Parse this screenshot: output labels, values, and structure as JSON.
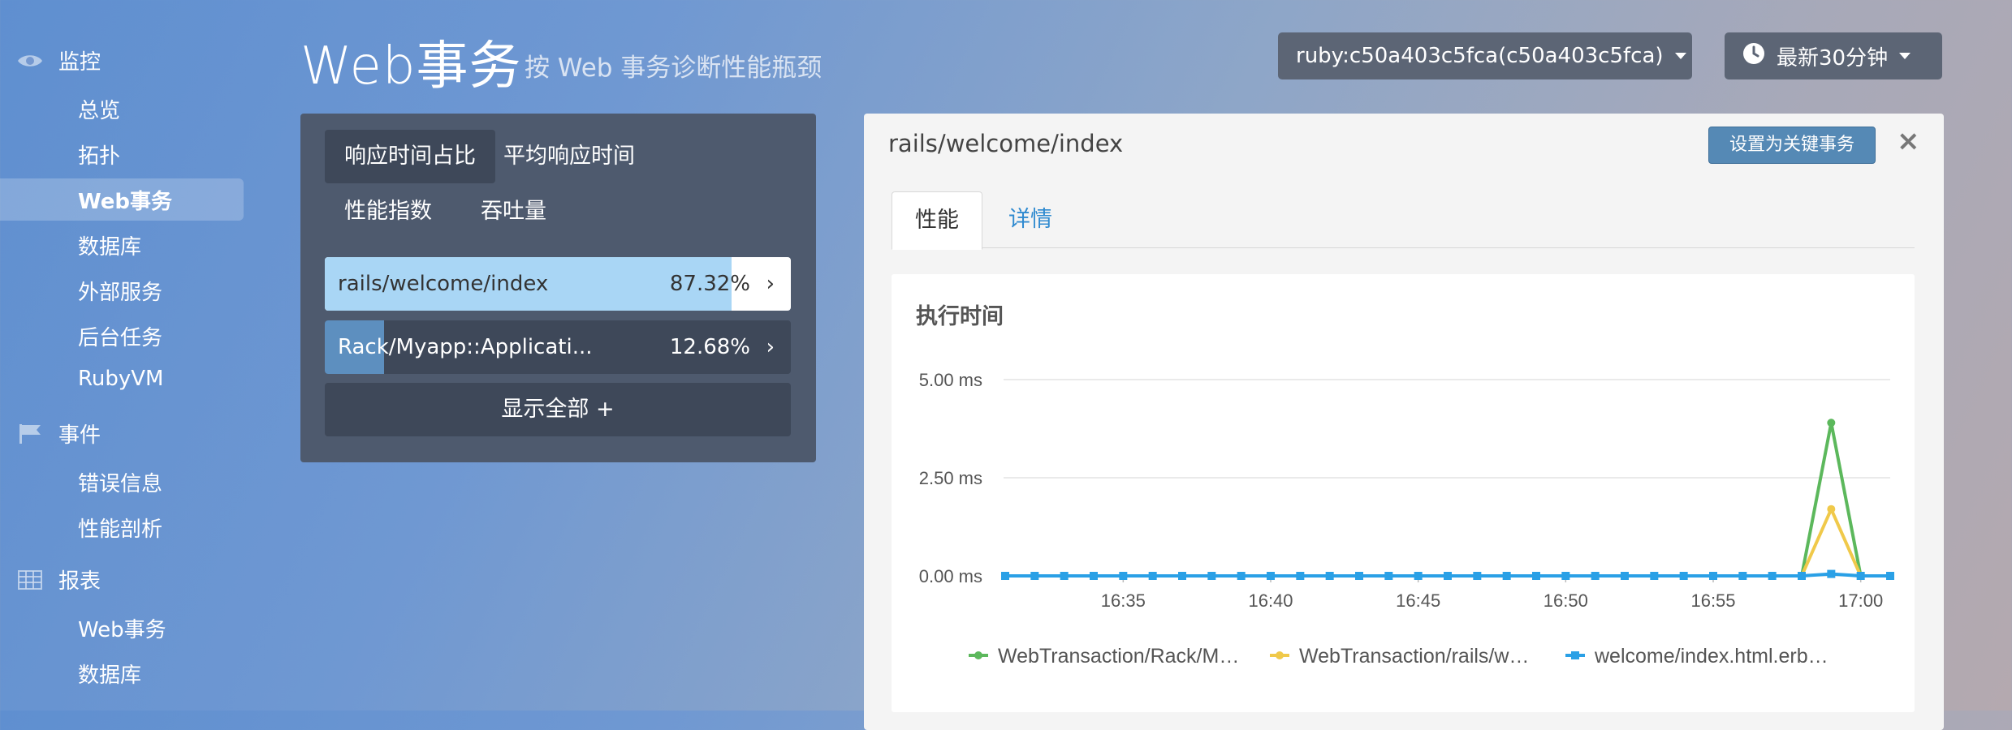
{
  "sidebar": {
    "groups": [
      {
        "label": "监控",
        "icon": "eye-icon",
        "items": [
          "总览",
          "拓扑",
          "Web事务",
          "数据库",
          "外部服务",
          "后台任务",
          "RubyVM"
        ]
      },
      {
        "label": "事件",
        "icon": "flag-icon",
        "items": [
          "错误信息",
          "性能剖析"
        ]
      },
      {
        "label": "报表",
        "icon": "table-icon",
        "items": [
          "Web事务",
          "数据库"
        ]
      }
    ],
    "active_item": "Web事务"
  },
  "header": {
    "title": "Web事务",
    "subtitle": "按 Web 事务诊断性能瓶颈",
    "app_selector": "ruby:c50a403c5fca(c50a403c5fca)",
    "time_selector": "最新30分钟"
  },
  "left_panel": {
    "tabs": [
      "响应时间占比",
      "平均响应时间",
      "性能指数",
      "吞吐量"
    ],
    "active_tab": "响应时间占比",
    "rows": [
      {
        "name": "rails/welcome/index",
        "pct_label": "87.32%",
        "fraction": 0.8732
      },
      {
        "name": "Rack/Myapp::Applicati...",
        "pct_label": "12.68%",
        "fraction": 0.1268
      }
    ],
    "show_all": "显示全部 +"
  },
  "right_panel": {
    "title": "rails/welcome/index",
    "key_button": "设置为关键事务",
    "close": "×",
    "tabs": [
      "性能",
      "详情"
    ],
    "active_tab": "性能",
    "card_title": "执行时间"
  },
  "colors": {
    "green": "#5cb85c",
    "yellow": "#f0c94a",
    "blue": "#2aa0e6"
  },
  "chart_data": {
    "type": "line",
    "title": "执行时间",
    "x_ticks": [
      "16:35",
      "16:40",
      "16:45",
      "16:50",
      "16:55",
      "17:00"
    ],
    "y_ticks": [
      "5.00 ms",
      "2.50 ms",
      "0.00 ms"
    ],
    "ylim": [
      0,
      5
    ],
    "x": [
      "16:31",
      "16:32",
      "16:33",
      "16:34",
      "16:35",
      "16:36",
      "16:37",
      "16:38",
      "16:39",
      "16:40",
      "16:41",
      "16:42",
      "16:43",
      "16:44",
      "16:45",
      "16:46",
      "16:47",
      "16:48",
      "16:49",
      "16:50",
      "16:51",
      "16:52",
      "16:53",
      "16:54",
      "16:55",
      "16:56",
      "16:57",
      "16:58",
      "16:59",
      "17:00",
      "17:01"
    ],
    "grid": true,
    "legend_position": "bottom",
    "series": [
      {
        "name": "WebTransaction/Rack/M…",
        "color": "#5cb85c",
        "marker": "circle",
        "values": [
          0,
          0,
          0,
          0,
          0,
          0,
          0,
          0,
          0,
          0,
          0,
          0,
          0,
          0,
          0,
          0,
          0,
          0,
          0,
          0,
          0,
          0,
          0,
          0,
          0,
          0,
          0,
          0,
          3.9,
          0,
          0
        ]
      },
      {
        "name": "WebTransaction/rails/w…",
        "color": "#f0c94a",
        "marker": "circle",
        "values": [
          0,
          0,
          0,
          0,
          0,
          0,
          0,
          0,
          0,
          0,
          0,
          0,
          0,
          0,
          0,
          0,
          0,
          0,
          0,
          0,
          0,
          0,
          0,
          0,
          0,
          0,
          0,
          0,
          1.7,
          0,
          0
        ]
      },
      {
        "name": "welcome/index.html.erb…",
        "color": "#2aa0e6",
        "marker": "square",
        "values": [
          0,
          0,
          0,
          0,
          0,
          0,
          0,
          0,
          0,
          0,
          0,
          0,
          0,
          0,
          0,
          0,
          0,
          0,
          0,
          0,
          0,
          0,
          0,
          0,
          0,
          0,
          0,
          0,
          0.05,
          0,
          0
        ]
      }
    ]
  }
}
